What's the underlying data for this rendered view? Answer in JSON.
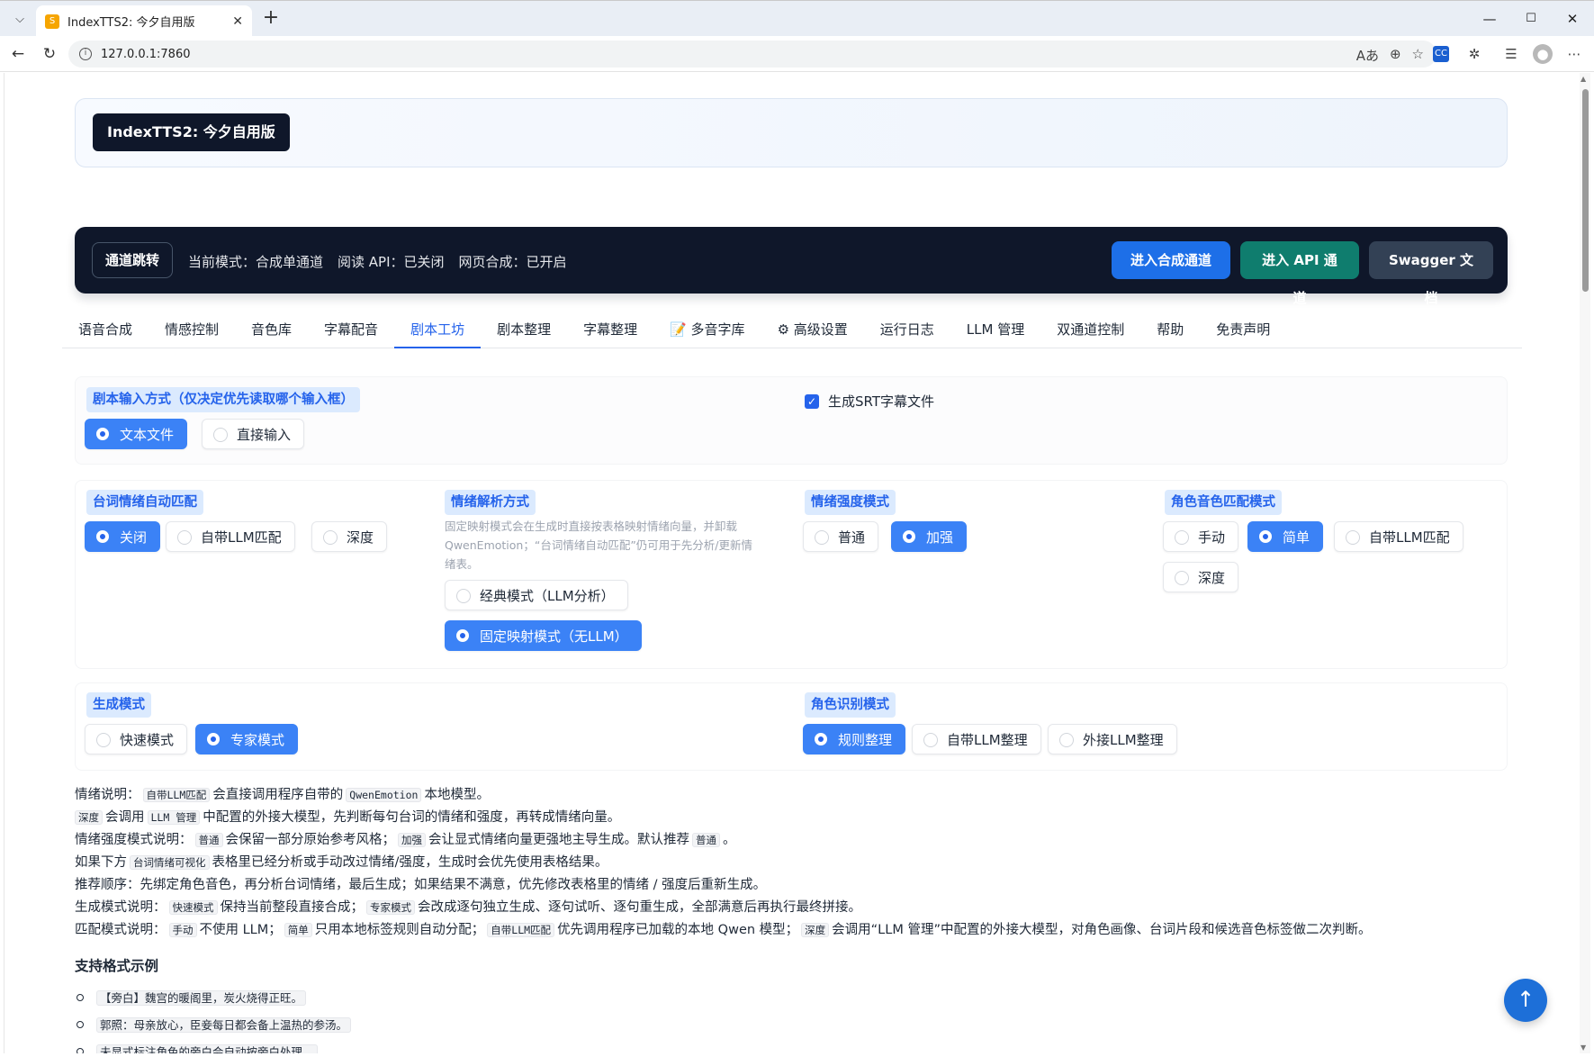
{
  "browser": {
    "tab_title": "IndexTTS2: 今夕自用版",
    "tab_close": "✕",
    "new_tab": "+",
    "url": "127.0.0.1:7860",
    "window_controls": [
      "—",
      "☐",
      "✕"
    ]
  },
  "header": {
    "badge": "IndexTTS2: 今夕自用版"
  },
  "channel": {
    "label": "通道跳转",
    "status": [
      "当前模式：合成单通道",
      "阅读 API：已关闭",
      "网页合成：已开启"
    ],
    "buttons": [
      {
        "label": "进入合成通道",
        "color": "#1d6fe8"
      },
      {
        "label": "进入 API 通道",
        "color": "#0f7d6e"
      },
      {
        "label": "Swagger 文档",
        "color": "#334155"
      }
    ]
  },
  "tabs": [
    "语音合成",
    "情感控制",
    "音色库",
    "字幕配音",
    "剧本工坊",
    "剧本整理",
    "字幕整理",
    "📝 多音字库",
    "⚙ 高级设置",
    "运行日志",
    "LLM 管理",
    "双通道控制",
    "帮助",
    "免责声明"
  ],
  "active_tab": "剧本工坊",
  "panel1": {
    "input_label": "剧本输入方式（仅决定优先读取哪个输入框）",
    "input_options": [
      "文本文件",
      "直接输入"
    ],
    "input_selected": "文本文件",
    "srt_label": "生成SRT字幕文件",
    "srt_checked": true
  },
  "panel2": {
    "auto_match": {
      "label": "台词情绪自动匹配",
      "options": [
        "关闭",
        "自带LLM匹配",
        "深度"
      ],
      "selected": "关闭"
    },
    "parse": {
      "label": "情绪解析方式",
      "hint": [
        "固定映射模式会在生成时直接按表格映射情绪向量，并卸载",
        "QwenEmotion；“台词情绪自动匹配”仍可用于先分析/更新情",
        "绪表。"
      ],
      "options": [
        "经典模式（LLM分析）",
        "固定映射模式（无LLM）"
      ],
      "selected": "固定映射模式（无LLM）"
    },
    "strength": {
      "label": "情绪强度模式",
      "options": [
        "普通",
        "加强"
      ],
      "selected": "加强"
    },
    "voice_match": {
      "label": "角色音色匹配模式",
      "options": [
        "手动",
        "简单",
        "自带LLM匹配",
        "深度"
      ],
      "selected": "简单"
    }
  },
  "panel3": {
    "gen_mode": {
      "label": "生成模式",
      "options": [
        "快速模式",
        "专家模式"
      ],
      "selected": "专家模式"
    },
    "role_mode": {
      "label": "角色识别模式",
      "options": [
        "规则整理",
        "自带LLM整理",
        "外接LLM整理"
      ],
      "selected": "规则整理"
    }
  },
  "notes": {
    "l1": [
      "情绪说明：",
      "自带LLM匹配",
      "会直接调用程序自带的",
      "QwenEmotion",
      "本地模型。"
    ],
    "l2": [
      "深度",
      "会调用",
      "LLM 管理",
      "中配置的外接大模型，先判断每句台词的情绪和强度，再转成情绪向量。"
    ],
    "l3": [
      "情绪强度模式说明：",
      "普通",
      "会保留一部分原始参考风格；",
      "加强",
      "会让显式情绪向量更强地主导生成。默认推荐",
      "普通",
      "。"
    ],
    "l4": [
      "如果下方",
      "台词情绪可视化",
      "表格里已经分析或手动改过情绪/强度，生成时会优先使用表格结果。"
    ],
    "l5": [
      "推荐顺序：先绑定角色音色，再分析台词情绪，最后生成；如果结果不满意，优先修改表格里的情绪 / 强度后重新生成。"
    ],
    "l6": [
      "生成模式说明：",
      "快速模式",
      "保持当前整段直接合成；",
      "专家模式",
      "会改成逐句独立生成、逐句试听、逐句重生成，全部满意后再执行最终拼接。"
    ],
    "l7": [
      "匹配模式说明：",
      "手动",
      "不使用 LLM；",
      "简单",
      "只用本地标签规则自动分配；",
      "自带LLM匹配",
      "优先调用程序已加载的本地 Qwen 模型；",
      "深度",
      "会调用“LLM 管理”中配置的外接大模型，对角色画像、台词片段和候选音色标签做二次判断。"
    ]
  },
  "examples": {
    "title": "支持格式示例",
    "items": [
      "【旁白】魏宫的暖阁里，炭火烧得正旺。",
      "郭照：母亲放心，臣妾每日都会备上温热的参汤。",
      "未显式标注角色的旁白会自动按旁白处理。"
    ]
  },
  "to_top": "↑",
  "colors": {
    "accent": "#2563eb",
    "dark": "#0f172a"
  }
}
